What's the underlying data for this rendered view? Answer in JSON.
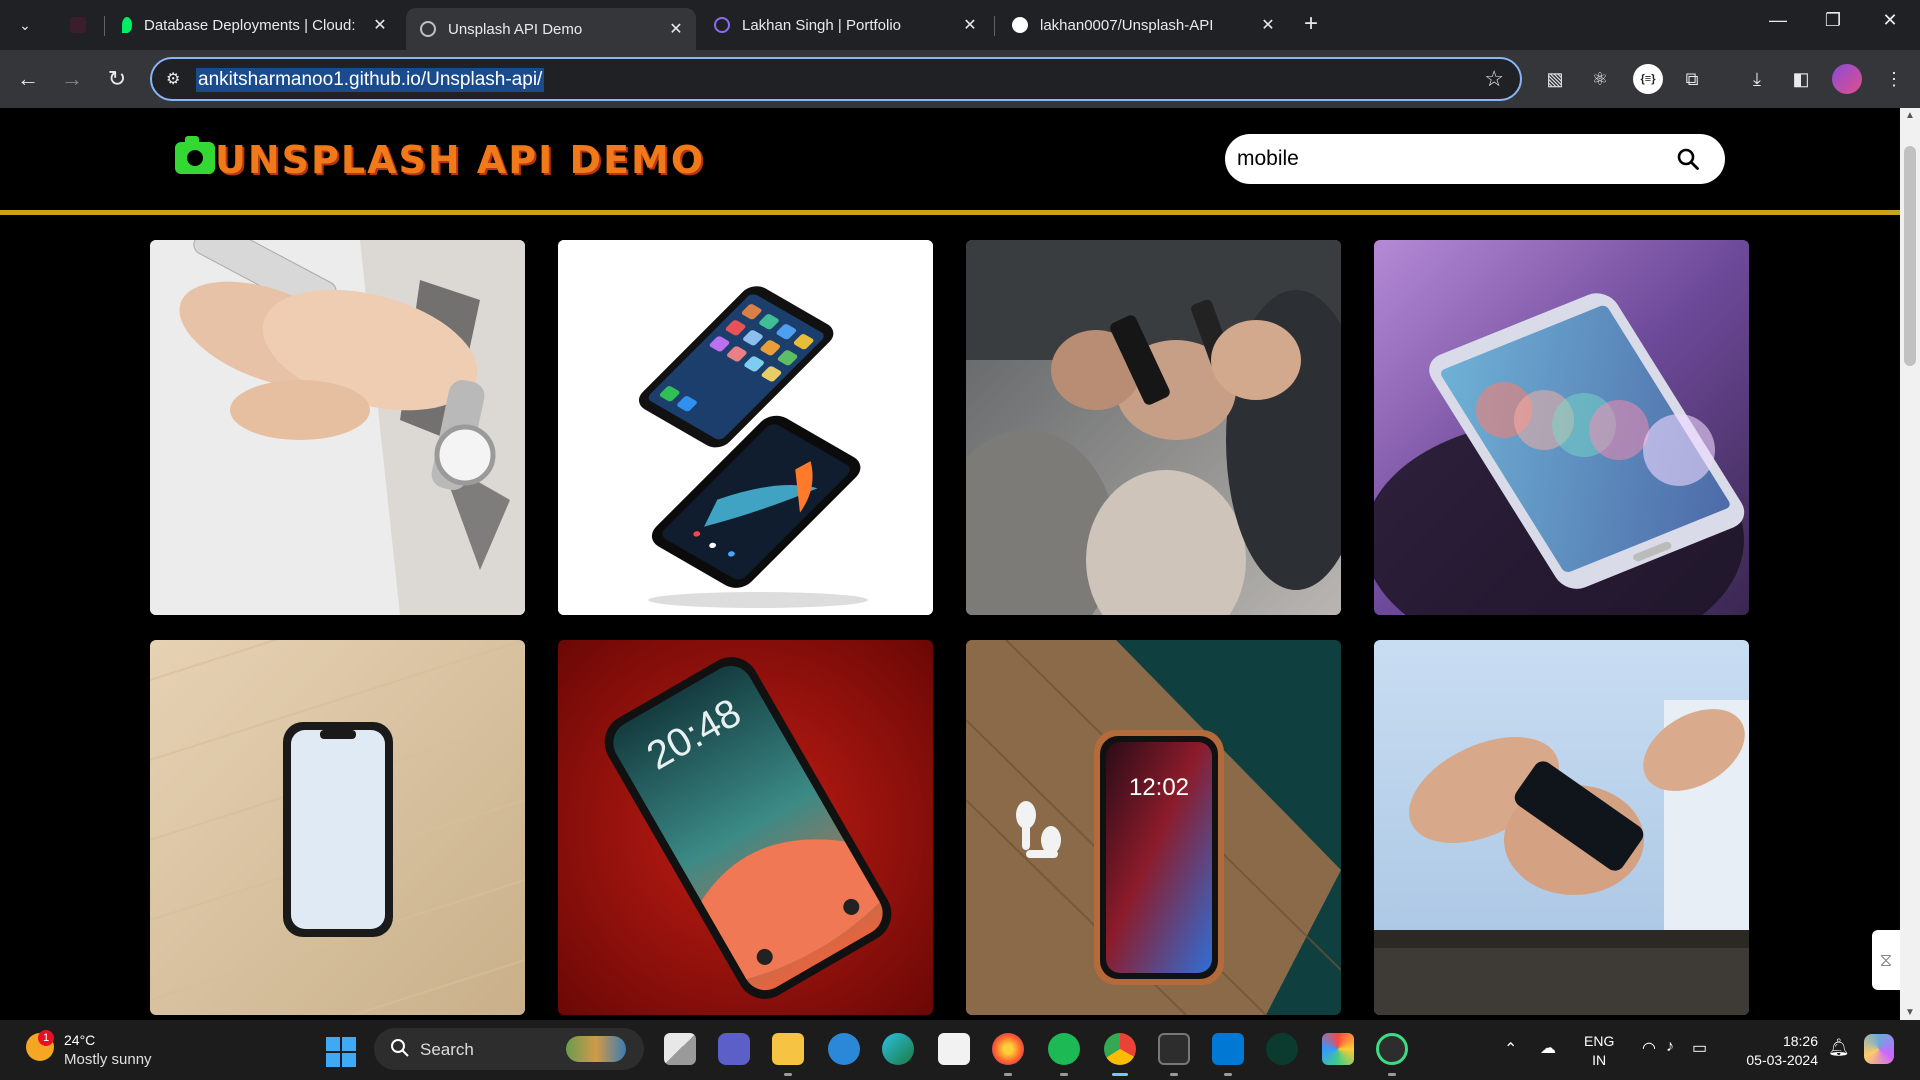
{
  "browser": {
    "tabs": [
      {
        "title": "",
        "active": false
      },
      {
        "title": "Database Deployments | Cloud:",
        "active": false
      },
      {
        "title": "Unsplash API Demo",
        "active": true
      },
      {
        "title": "Lakhan Singh | Portfolio",
        "active": false
      },
      {
        "title": "lakhan0007/Unsplash-API",
        "active": false
      }
    ],
    "url": "ankitsharmanoo1.github.io/Unsplash-api/"
  },
  "site": {
    "logo_text": "UNSPLASH API DEMO",
    "search_value": "mobile"
  },
  "gallery": {
    "images": [
      {
        "label": "hands texting on phone with silver watch"
      },
      {
        "label": "two black smartphones on white"
      },
      {
        "label": "people using phones in a row"
      },
      {
        "label": "hand holding phone with bokeh lights"
      },
      {
        "label": "smartphone on wooden table"
      },
      {
        "label": "phone lock screen 20:48 on red"
      },
      {
        "label": "iphone 12:02 with airpods on wood"
      },
      {
        "label": "man in blue shirt holding phone"
      }
    ],
    "lock_screen_1": {
      "time": "20:48"
    },
    "lock_screen_2": {
      "time": "12:02"
    }
  },
  "taskbar": {
    "weather_temp": "24°C",
    "weather_desc": "Mostly sunny",
    "weather_badge": "1",
    "search_label": "Search",
    "lang_top": "ENG",
    "lang_bottom": "IN",
    "time": "18:26",
    "date": "05-03-2024"
  },
  "colors": {
    "accent_gold": "#c9a21b",
    "logo_orange": "#f07a1a",
    "logo_green": "#34d832"
  }
}
